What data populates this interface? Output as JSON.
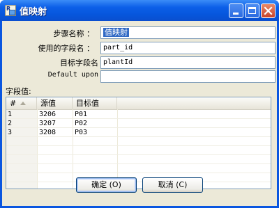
{
  "window": {
    "title": "值映射"
  },
  "form": {
    "step_name": {
      "label": "步骤名称 ：",
      "value": "值映射"
    },
    "field_name": {
      "label": "使用的字段名 ：",
      "value": "part_id"
    },
    "target_field": {
      "label": "目标字段名",
      "value": "plantId"
    },
    "default_upon": {
      "label": "Default upon",
      "value": ""
    }
  },
  "grid": {
    "section_label": "字段值:",
    "columns": [
      "#",
      "源值",
      "目标值"
    ],
    "rows": [
      [
        "1",
        "3206",
        "P01"
      ],
      [
        "2",
        "3207",
        "P02"
      ],
      [
        "3",
        "3208",
        "P03"
      ]
    ]
  },
  "buttons": {
    "ok": "确定 (O)",
    "cancel": "取消 (C)"
  },
  "icons": {
    "title_buttons": [
      "minimize-icon",
      "maximize-icon",
      "close-icon"
    ],
    "sort": "sort-up-icon"
  }
}
